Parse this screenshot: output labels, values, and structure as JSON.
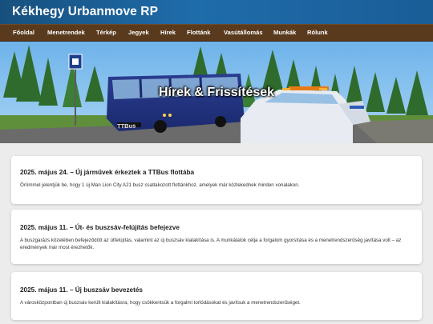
{
  "site": {
    "title": "Kékhegy Urbanmove RP"
  },
  "nav": {
    "items": [
      {
        "label": "Főoldal"
      },
      {
        "label": "Menetrendek"
      },
      {
        "label": "Térkép"
      },
      {
        "label": "Jegyek"
      },
      {
        "label": "Hírek"
      },
      {
        "label": "Flottánk"
      },
      {
        "label": "Vasútállomás"
      },
      {
        "label": "Munkák"
      },
      {
        "label": "Rólunk"
      }
    ]
  },
  "hero": {
    "title": "Hírek & Frissítések",
    "bus_label": "TTBus"
  },
  "news": [
    {
      "title": "2025. május 24. – Új járművek érkeztek a TTBus flottába",
      "body": "Örömmel jelentjük be, hogy 1 új Man Lion City A21 busz csatlakozott flottánkhoz, amelyek már közlekednek minden vonalakon."
    },
    {
      "title": "2025. május 11. – Út- és buszsáv-felújítás befejezve",
      "body": "A buszgarázs közelében befejeződött az útfelújítás, valamint az új buszsáv kialakítása is. A munkálatok célja a forgalom gyorsítása és a menetrendszerűség javítása volt – az eredmények már most érezhetők."
    },
    {
      "title": "2025. május 11. – Új buszsáv bevezetés",
      "body": "A városközpontban új buszsáv került kialakításra, hogy csökkentsük a forgalmi torlódásokat és javítsuk a menetrendszerűséget."
    }
  ]
}
